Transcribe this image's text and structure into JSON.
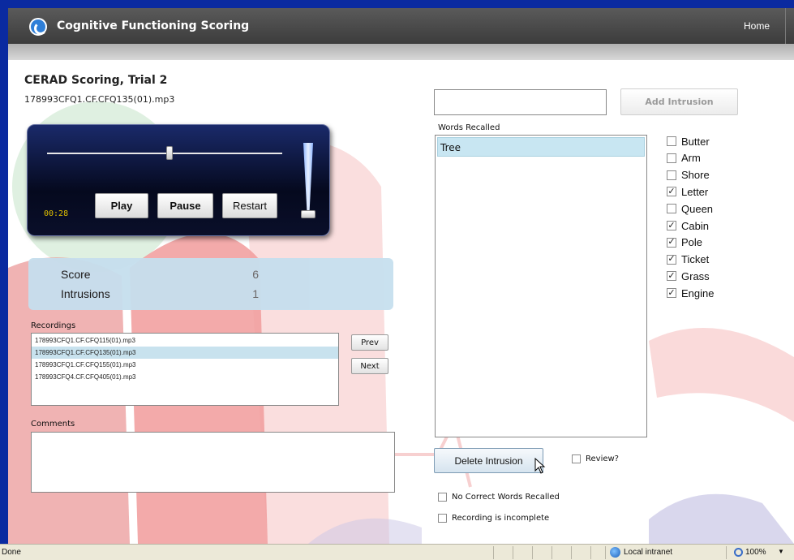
{
  "header": {
    "app_title": "Cognitive Functioning Scoring",
    "home_link": "Home"
  },
  "page": {
    "title": "CERAD Scoring, Trial 2",
    "file_name": "178993CFQ1.CF.CFQ135(01).mp3"
  },
  "player": {
    "time": "00:28",
    "play_label": "Play",
    "pause_label": "Pause",
    "restart_label": "Restart",
    "position_fraction": 0.52,
    "volume_fraction": 0.0
  },
  "score": {
    "score_label": "Score",
    "score_value": "6",
    "intrusions_label": "Intrusions",
    "intrusions_value": "1"
  },
  "recordings": {
    "label": "Recordings",
    "items": [
      "178993CFQ1.CF.CFQ115(01).mp3",
      "178993CFQ1.CF.CFQ135(01).mp3",
      "178993CFQ1.CF.CFQ155(01).mp3",
      "178993CFQ4.CF.CFQ405(01).mp3"
    ],
    "selected_index": 1,
    "prev_label": "Prev",
    "next_label": "Next"
  },
  "comments": {
    "label": "Comments",
    "value": ""
  },
  "intrusion": {
    "input_value": "",
    "add_label": "Add Intrusion",
    "delete_label": "Delete Intrusion"
  },
  "words_recalled": {
    "label": "Words Recalled",
    "items": [
      "Tree"
    ]
  },
  "word_checklist": [
    {
      "word": "Butter",
      "checked": false
    },
    {
      "word": "Arm",
      "checked": false
    },
    {
      "word": "Shore",
      "checked": false
    },
    {
      "word": "Letter",
      "checked": true
    },
    {
      "word": "Queen",
      "checked": false
    },
    {
      "word": "Cabin",
      "checked": true
    },
    {
      "word": "Pole",
      "checked": true
    },
    {
      "word": "Ticket",
      "checked": true
    },
    {
      "word": "Grass",
      "checked": true
    },
    {
      "word": "Engine",
      "checked": true
    }
  ],
  "options": {
    "review_label": "Review?",
    "review_checked": false,
    "no_correct_label": "No Correct Words Recalled",
    "no_correct_checked": false,
    "incomplete_label": "Recording is incomplete",
    "incomplete_checked": false
  },
  "statusbar": {
    "status": "Done",
    "zone": "Local intranet",
    "zoom": "100%"
  },
  "colors": {
    "header_bg": "#4a4a4a",
    "frame": "#0a2aa0",
    "selection": "#c8e2ee",
    "score_bg": "#c6dfee",
    "timer": "#e0c000"
  }
}
